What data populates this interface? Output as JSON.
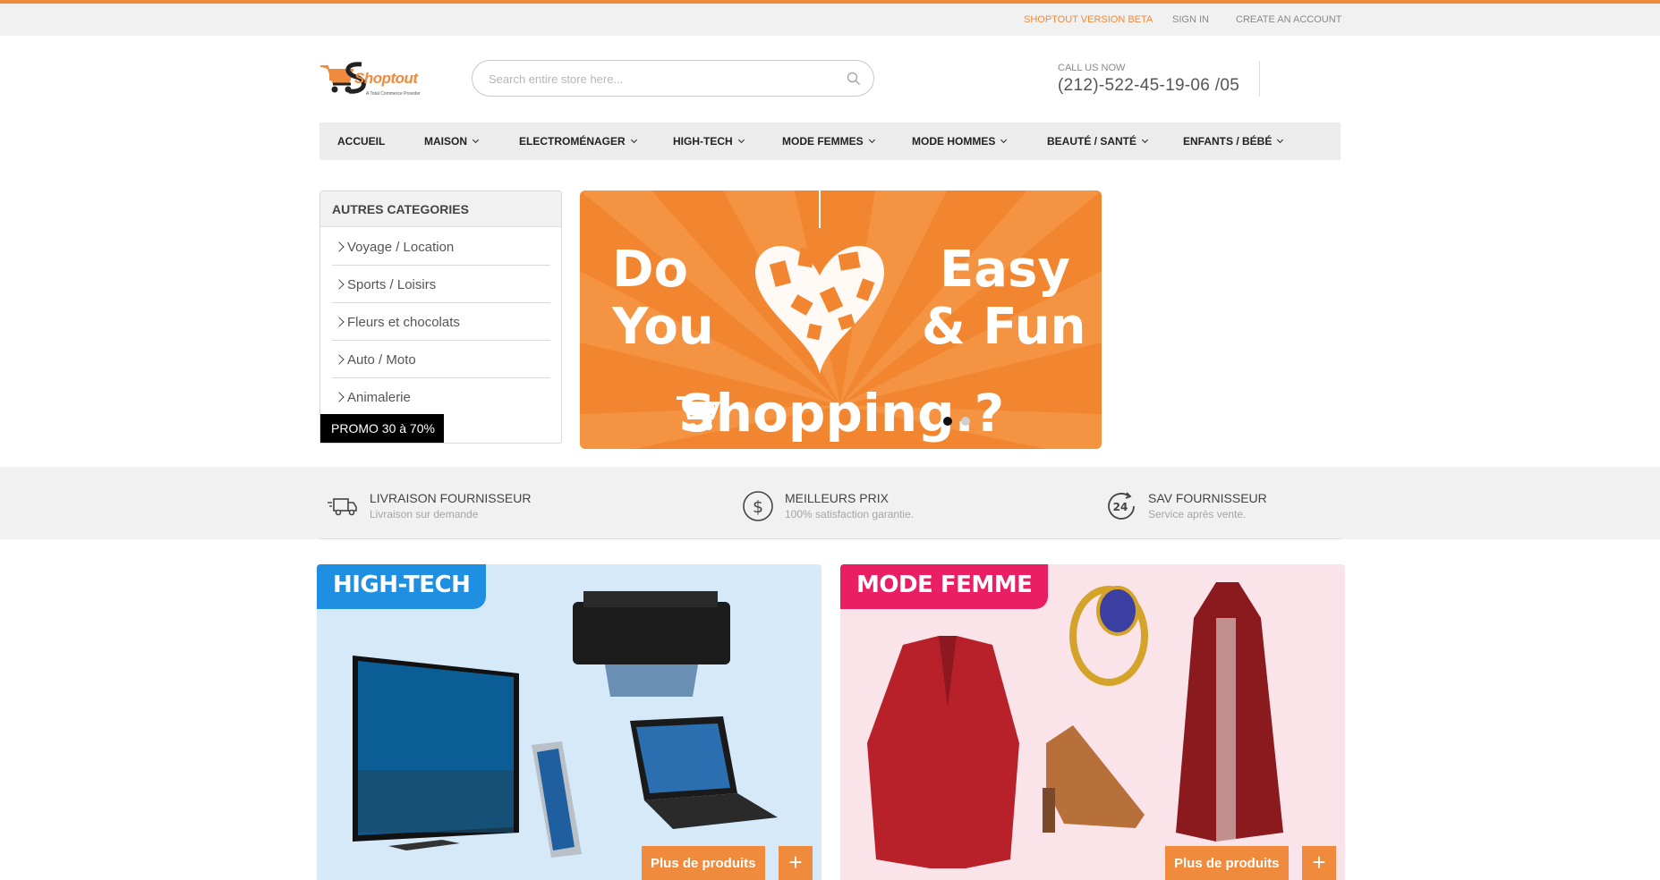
{
  "topbar": {
    "beta_label": "SHOPTOUT VERSION BETA",
    "signin_label": "SIGN IN",
    "create_account_label": "CREATE AN ACCOUNT"
  },
  "logo": {
    "brand": "Shoptout",
    "tagline": "A Total Commerce Provider"
  },
  "search": {
    "placeholder": "Search entire store here..."
  },
  "contact": {
    "label": "CALL US NOW",
    "phone": "(212)-522-45-19-06 /05"
  },
  "nav": {
    "items": [
      {
        "label": "ACCUEIL"
      },
      {
        "label": "MAISON"
      },
      {
        "label": "ELECTROMÉNAGER"
      },
      {
        "label": "HIGH-TECH"
      },
      {
        "label": "MODE FEMMES"
      },
      {
        "label": "MODE HOMMES"
      },
      {
        "label": "BEAUTÉ / SANTÉ"
      },
      {
        "label": "ENFANTS / BÉBÉ"
      }
    ]
  },
  "sidebar": {
    "title": "AUTRES CATEGORIES",
    "items": [
      {
        "label": "Voyage / Location"
      },
      {
        "label": "Sports / Loisirs"
      },
      {
        "label": "Fleurs et chocolats"
      },
      {
        "label": "Auto / Moto"
      },
      {
        "label": "Animalerie"
      }
    ],
    "promo_label": "PROMO 30 à 70%"
  },
  "banner": {
    "left_line1": "Do",
    "left_line2": "You",
    "right_line1": "Easy",
    "right_line2": "& Fun",
    "bottom": "hopping.?",
    "bottom_initial": "S",
    "active_slide": 1,
    "slide_count": 2
  },
  "features": [
    {
      "title": "LIVRAISON FOURNISSEUR",
      "subtitle": "Livraison sur demande",
      "icon": "delivery-truck-icon"
    },
    {
      "title": "MEILLEURS PRIX",
      "subtitle": "100% satisfaction garantie.",
      "icon": "dollar-circle-icon"
    },
    {
      "title": "SAV FOURNISSEUR",
      "subtitle": "Service après vente.",
      "icon": "24h-service-icon"
    }
  ],
  "promo_cards": [
    {
      "title": "HIGH-TECH",
      "button": "Plus de produits",
      "plus": "+",
      "bg": "#d6e9f8",
      "accent": "#1e8fe1"
    },
    {
      "title": "MODE FEMME",
      "button": "Plus de produits",
      "plus": "+",
      "bg": "#fbe3ea",
      "accent": "#e91e63"
    }
  ],
  "colors": {
    "accent": "#f08a3c",
    "nav_bg": "#ececec",
    "topbar_bg": "#f1f1f1"
  }
}
